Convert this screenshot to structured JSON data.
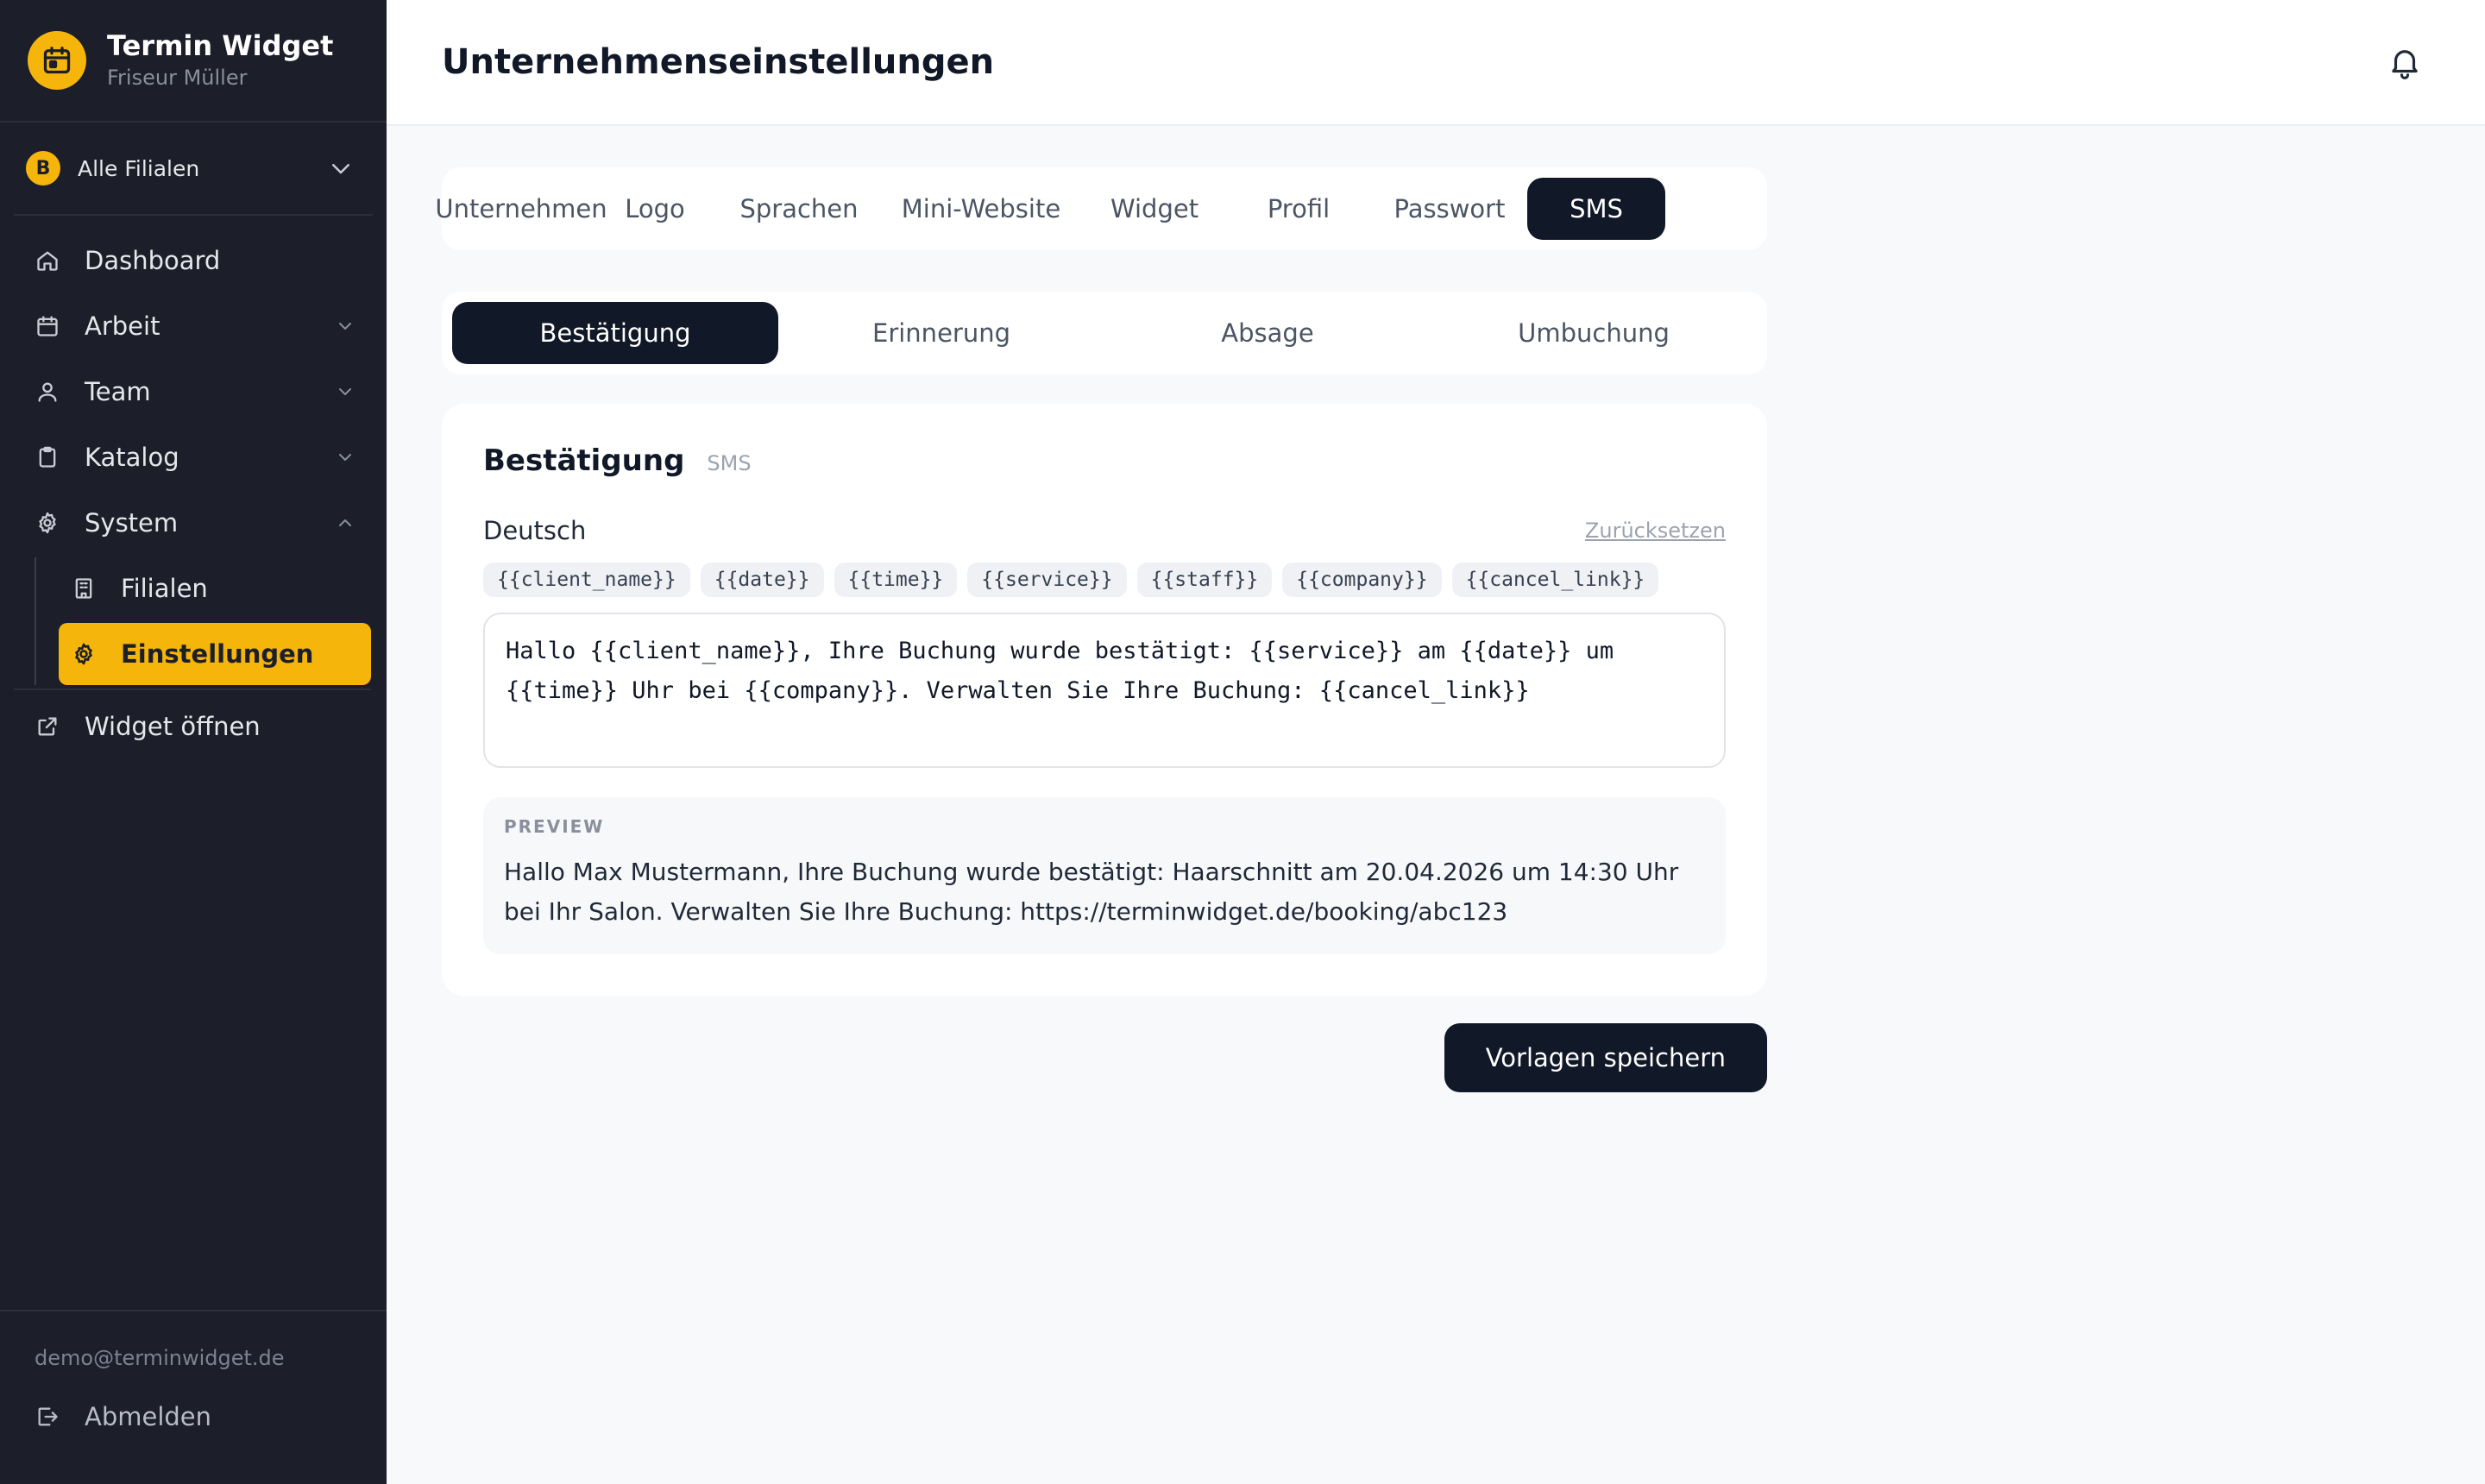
{
  "brand": {
    "title": "Termin Widget",
    "subtitle": "Friseur Müller",
    "icon": "calendar-icon",
    "accent": "#f5b50a"
  },
  "branch": {
    "badge": "B",
    "label": "Alle Filialen"
  },
  "nav": {
    "dashboard": "Dashboard",
    "arbeit": "Arbeit",
    "team": "Team",
    "katalog": "Katalog",
    "system": "System",
    "filialen": "Filialen",
    "einstellungen": "Einstellungen",
    "widget_open": "Widget öffnen"
  },
  "footer": {
    "email": "demo@terminwidget.de",
    "logout": "Abmelden"
  },
  "header": {
    "title": "Unternehmenseinstellungen",
    "bell_icon": "bell-icon"
  },
  "tabs": [
    {
      "label": "Unternehmen"
    },
    {
      "label": "Logo"
    },
    {
      "label": "Sprachen"
    },
    {
      "label": "Mini-Website"
    },
    {
      "label": "Widget"
    },
    {
      "label": "Profil"
    },
    {
      "label": "Passwort"
    },
    {
      "label": "SMS",
      "active": true
    }
  ],
  "subtabs": [
    {
      "label": "Bestätigung",
      "active": true
    },
    {
      "label": "Erinnerung"
    },
    {
      "label": "Absage"
    },
    {
      "label": "Umbuchung"
    }
  ],
  "card": {
    "title": "Bestätigung",
    "tag": "SMS",
    "field_label": "Deutsch",
    "reset": "Zurücksetzen",
    "chips": [
      "{{client_name}}",
      "{{date}}",
      "{{time}}",
      "{{service}}",
      "{{staff}}",
      "{{company}}",
      "{{cancel_link}}"
    ],
    "template": "Hallo {{client_name}}, Ihre Buchung wurde bestätigt: {{service}} am {{date}} um {{time}} Uhr bei {{company}}. Verwalten Sie Ihre Buchung: {{cancel_link}}",
    "preview_label": "PREVIEW",
    "preview_text": "Hallo Max Mustermann, Ihre Buchung wurde bestätigt: Haarschnitt am 20.04.2026 um 14:30 Uhr bei Ihr Salon. Verwalten Sie Ihre Buchung: https://terminwidget.de/booking/abc123"
  },
  "actions": {
    "save": "Vorlagen speichern"
  }
}
